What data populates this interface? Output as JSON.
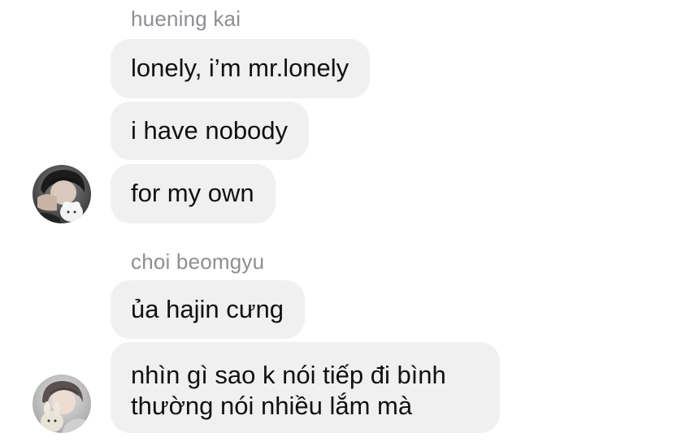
{
  "groups": [
    {
      "sender": "huening kai",
      "messages": [
        "lonely, i’m mr.lonely",
        "i have nobody",
        "for my own"
      ]
    },
    {
      "sender": "choi beomgyu",
      "messages": [
        "ủa hajin cưng"
      ],
      "last_message_lines": [
        "nhìn gì sao k nói tiếp đi bình",
        "thường nói nhiều lắm mà"
      ]
    }
  ],
  "colors": {
    "bubble": "#f0f0f0",
    "sender_name": "#8e8e93",
    "text": "#111111"
  }
}
